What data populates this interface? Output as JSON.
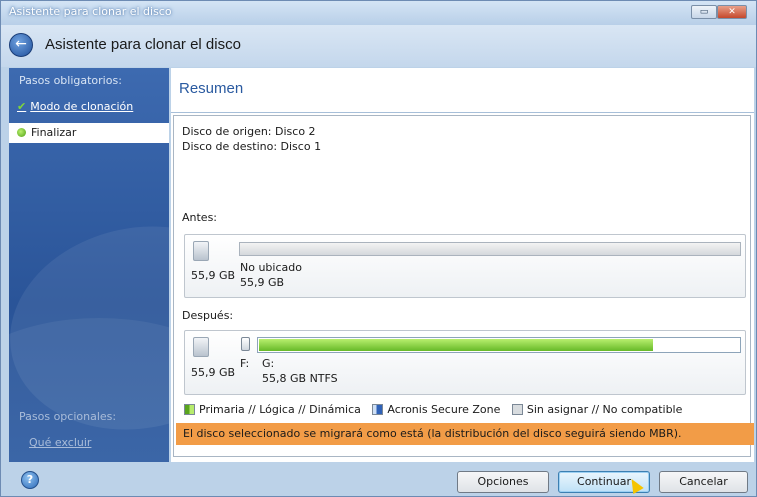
{
  "window": {
    "title": "Asistente para clonar el disco",
    "restore_icon": "restore-icon",
    "close_icon": "close-icon"
  },
  "header": {
    "title": "Asistente para clonar el disco"
  },
  "sidebar": {
    "required_heading": "Pasos obligatorios:",
    "items": [
      {
        "label": "Modo de clonación",
        "state": "completed"
      },
      {
        "label": "Finalizar",
        "state": "current"
      }
    ],
    "optional_heading": "Pasos opcionales:",
    "optional_link": "Qué excluir"
  },
  "main": {
    "section_title": "Resumen",
    "source_disk": "Disco de origen: Disco 2",
    "target_disk": "Disco de destino: Disco 1",
    "before": {
      "label": "Antes:",
      "disk_size": "55,9 GB",
      "partition_label": "No ubicado",
      "partition_size": "55,9 GB"
    },
    "after": {
      "label": "Después:",
      "disk_size": "55,9 GB",
      "drive_letter": "F:",
      "partition_label": "G:",
      "partition_size": "55,8 GB",
      "filesystem": "NTFS",
      "fill_fraction": 0.82
    },
    "legend": {
      "primary": "Primaria // Lógica // Dinámica",
      "acronis": "Acronis Secure Zone",
      "unallocated": "Sin asignar // No compatible"
    },
    "warning": "El disco seleccionado se migrará como está (la distribución del disco seguirá siendo MBR)."
  },
  "footer": {
    "options_button": "Opciones",
    "continue_button": "Continuar",
    "cancel_button": "Cancelar"
  },
  "colors": {
    "accent_blue": "#2a5aa0",
    "warning_orange": "#f29c47",
    "partition_green": "#66b928"
  }
}
